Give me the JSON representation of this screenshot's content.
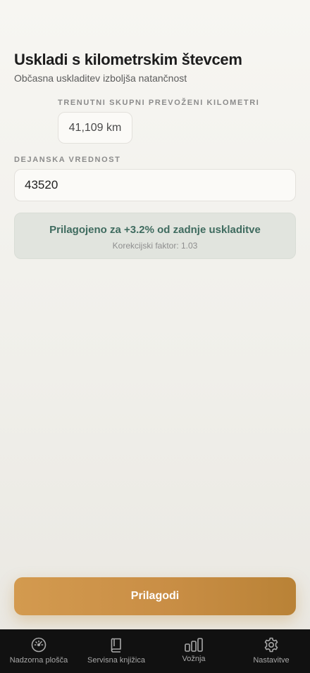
{
  "header": {
    "title": "Uskladi s kilometrskim števcem",
    "subtitle": "Občasna uskladitev izboljša natančnost"
  },
  "current": {
    "label": "TRENUTNI SKUPNI PREVOŽENI KILOMETRI",
    "value": "41,109 km"
  },
  "actual": {
    "label": "DEJANSKA VREDNOST",
    "value": "43520"
  },
  "info": {
    "main": "Prilagojeno za +3.2% od zadnje uskladitve",
    "sub": "Korekcijski faktor: 1.03"
  },
  "button": {
    "label": "Prilagodi"
  },
  "tabs": [
    {
      "label": "Nadzorna plošča",
      "icon": "speedometer-icon"
    },
    {
      "label": "Servisna knjižica",
      "icon": "book-icon"
    },
    {
      "label": "Vožnja",
      "icon": "bar-chart-icon"
    },
    {
      "label": "Nastavitve",
      "icon": "gear-icon"
    }
  ],
  "colors": {
    "accent": "#c98e45",
    "info_text": "#3f6b5f",
    "tab_bar": "#111111"
  }
}
